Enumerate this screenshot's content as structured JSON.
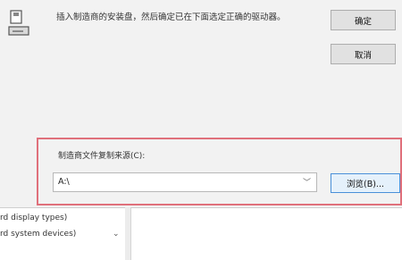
{
  "dialog": {
    "message": "插入制造商的安装盘，然后确定已在下面选定正确的驱动器。",
    "ok_label": "确定",
    "cancel_label": "取消",
    "copy_from_label": "制造商文件复制来源(C):",
    "path_value": "A:\\",
    "browse_label": "浏览(B)..."
  },
  "background_list": {
    "items": [
      "rd display types)",
      "rd system devices)"
    ]
  },
  "colors": {
    "highlight_border": "#e0707b",
    "browse_border": "#4a90d9"
  }
}
